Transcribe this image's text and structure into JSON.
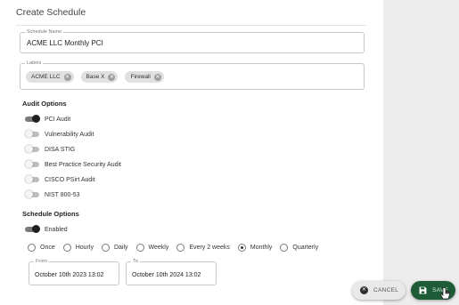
{
  "dialog": {
    "title": "Create Schedule"
  },
  "schedule_name": {
    "label": "Schedule Name",
    "value": "ACME LLC Monthly PCI"
  },
  "labels": {
    "label": "Labels",
    "chips": [
      "ACME LLC",
      "Base X",
      "Firewall"
    ]
  },
  "audit_options": {
    "title": "Audit Options",
    "items": [
      {
        "label": "PCI Audit",
        "on": true
      },
      {
        "label": "Vulnerability Audit",
        "on": false
      },
      {
        "label": "DISA STIG",
        "on": false
      },
      {
        "label": "Best Practice Security Audit",
        "on": false
      },
      {
        "label": "CISCO PSirt Audit",
        "on": false
      },
      {
        "label": "NIST 800-53",
        "on": false
      }
    ]
  },
  "schedule_options": {
    "title": "Schedule Options",
    "enabled_label": "Enabled",
    "enabled": true,
    "frequencies": [
      "Once",
      "Hourly",
      "Daily",
      "Weekly",
      "Every 2 weeks",
      "Monthly",
      "Quarterly"
    ],
    "selected_frequency": "Monthly",
    "from_label": "From",
    "from_value": "October 10th 2023 13:02",
    "to_label": "To",
    "to_value": "October 10th 2024 13:02"
  },
  "buttons": {
    "cancel": "CANCEL",
    "save": "SAVE"
  },
  "colors": {
    "save_bg": "#1e5c37",
    "toggle_on": "#1f1f1f",
    "side_gray": "#ececec"
  }
}
